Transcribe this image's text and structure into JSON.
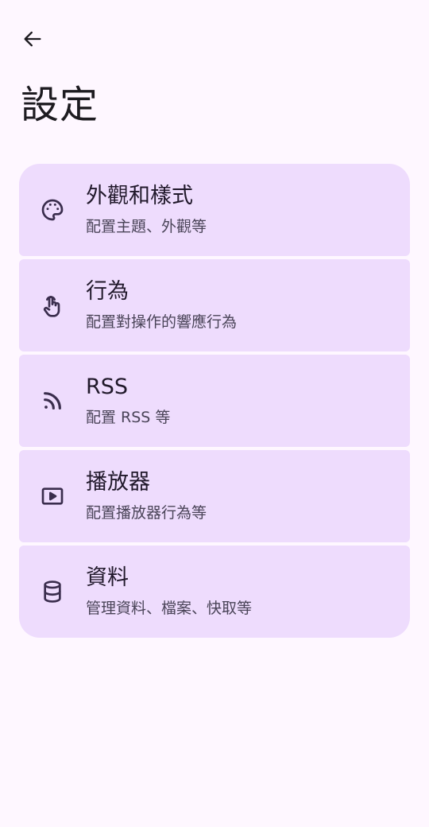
{
  "header": {
    "title": "設定",
    "back_icon": "arrow-left-icon"
  },
  "settings": {
    "items": [
      {
        "icon": "palette-icon",
        "title": "外觀和樣式",
        "subtitle": "配置主題、外觀等"
      },
      {
        "icon": "touch-icon",
        "title": "行為",
        "subtitle": "配置對操作的響應行為"
      },
      {
        "icon": "rss-icon",
        "title": "RSS",
        "subtitle": "配置 RSS 等"
      },
      {
        "icon": "play-icon",
        "title": "播放器",
        "subtitle": "配置播放器行為等"
      },
      {
        "icon": "database-icon",
        "title": "資料",
        "subtitle": "管理資料、檔案、快取等"
      }
    ]
  },
  "colors": {
    "background": "#FEF7FF",
    "card": "#EEDCFD",
    "icon": "#3A2D4D"
  }
}
